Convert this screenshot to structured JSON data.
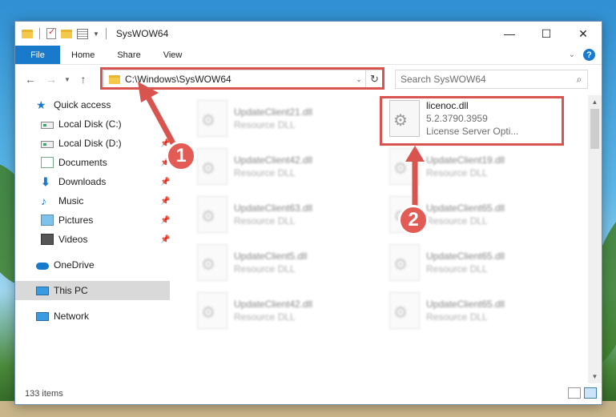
{
  "window": {
    "title": "SysWOW64",
    "controls": {
      "minimize": "—",
      "maximize": "☐",
      "close": "✕"
    }
  },
  "ribbon": {
    "tabs": [
      "File",
      "Home",
      "Share",
      "View"
    ],
    "help": "?"
  },
  "navigation": {
    "address": "C:\\Windows\\SysWOW64",
    "search_placeholder": "Search SysWOW64"
  },
  "sidebar": {
    "items": [
      {
        "label": "Quick access",
        "icon": "star-icon"
      },
      {
        "label": "Local Disk (C:)",
        "icon": "drive-icon",
        "pinned": true
      },
      {
        "label": "Local Disk (D:)",
        "icon": "drive-icon",
        "pinned": true
      },
      {
        "label": "Documents",
        "icon": "documents-icon",
        "pinned": true
      },
      {
        "label": "Downloads",
        "icon": "download-icon",
        "pinned": true
      },
      {
        "label": "Music",
        "icon": "music-icon",
        "pinned": true
      },
      {
        "label": "Pictures",
        "icon": "pictures-icon",
        "pinned": true
      },
      {
        "label": "Videos",
        "icon": "videos-icon",
        "pinned": true
      },
      {
        "label": "OneDrive",
        "icon": "onedrive-icon"
      },
      {
        "label": "This PC",
        "icon": "pc-icon",
        "selected": true
      },
      {
        "label": "Network",
        "icon": "network-icon"
      }
    ]
  },
  "files": {
    "highlighted": {
      "name": "licenoc.dll",
      "version": "5.2.3790.3959",
      "description": "License Server Opti..."
    },
    "blurred": [
      {
        "name": "UpdateClient21.dll",
        "desc": "Resource DLL"
      },
      {
        "name": "UpdateClient42.dll",
        "desc": "Resource DLL"
      },
      {
        "name": "UpdateClient19.dll",
        "desc": "Resource DLL"
      },
      {
        "name": "UpdateClient63.dll",
        "desc": "Resource DLL"
      },
      {
        "name": "UpdateClient65.dll",
        "desc": "Resource DLL"
      },
      {
        "name": "UpdateClient5.dll",
        "desc": "Resource DLL"
      },
      {
        "name": "UpdateClient65.dll",
        "desc": "Resource DLL"
      },
      {
        "name": "UpdateClient42.dll",
        "desc": "Resource DLL"
      },
      {
        "name": "UpdateClient65.dll",
        "desc": "Resource DLL"
      }
    ]
  },
  "status": {
    "item_count": "133 items"
  },
  "annotations": {
    "step1": "1",
    "step2": "2",
    "color": "#d9534f"
  }
}
